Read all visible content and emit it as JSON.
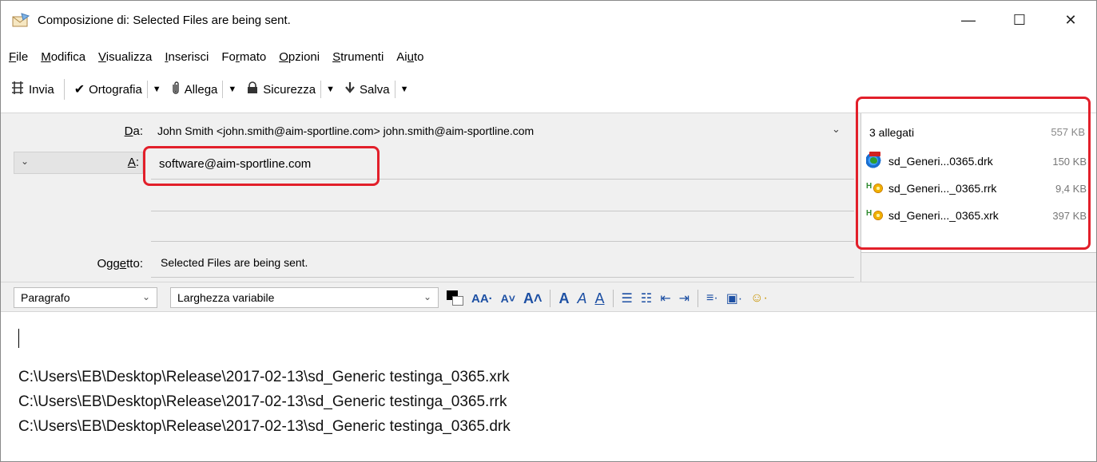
{
  "window": {
    "title": "Composizione di: Selected Files are being sent.",
    "controls": {
      "minimize": "—",
      "maximize": "☐",
      "close": "✕"
    }
  },
  "menu": [
    {
      "pre": "",
      "u": "F",
      "post": "ile"
    },
    {
      "pre": "",
      "u": "M",
      "post": "odifica"
    },
    {
      "pre": "",
      "u": "V",
      "post": "isualizza"
    },
    {
      "pre": "",
      "u": "I",
      "post": "nserisci"
    },
    {
      "pre": "Fo",
      "u": "r",
      "post": "mato"
    },
    {
      "pre": "",
      "u": "O",
      "post": "pzioni"
    },
    {
      "pre": "",
      "u": "S",
      "post": "trumenti"
    },
    {
      "pre": "Ai",
      "u": "u",
      "post": "to"
    }
  ],
  "toolbar": {
    "send": "Invia",
    "spelling": "Ortografia",
    "attach": "Allega",
    "security": "Sicurezza",
    "save": "Salva"
  },
  "header": {
    "from_label_u": "D",
    "from_label_rest": "a:",
    "from_value": "John Smith <john.smith@aim-sportline.com> john.smith@aim-sportline.com",
    "to_label_u": "A",
    "to_label_rest": ":",
    "to_value": "software@aim-sportline.com",
    "subject_label_pre": "Ogg",
    "subject_label_u": "e",
    "subject_label_post": "tto:",
    "subject_value": "Selected Files are being sent."
  },
  "attachments": {
    "count_label_pre": "3 alle",
    "count_label_u": "g",
    "count_label_post": "ati",
    "total_size": "557 KB",
    "items": [
      {
        "name": "sd_Generi...0365.drk",
        "size": "150 KB",
        "icon": "globe-icon"
      },
      {
        "name": "sd_Generi..._0365.rrk",
        "size": "9,4 KB",
        "icon": "log-file-icon"
      },
      {
        "name": "sd_Generi..._0365.xrk",
        "size": "397 KB",
        "icon": "log-file-icon"
      }
    ]
  },
  "format": {
    "paragraph": "Paragrafo",
    "font": "Larghezza variabile"
  },
  "body": {
    "lines": [
      "C:\\Users\\EB\\Desktop\\Release\\2017-02-13\\sd_Generic testinga_0365.xrk",
      "C:\\Users\\EB\\Desktop\\Release\\2017-02-13\\sd_Generic testinga_0365.rrk",
      "C:\\Users\\EB\\Desktop\\Release\\2017-02-13\\sd_Generic testinga_0365.drk"
    ]
  },
  "colors": {
    "highlight": "#e21f2a",
    "header_bg": "#f0f0f0",
    "format_icons": "#1c4fa3"
  }
}
